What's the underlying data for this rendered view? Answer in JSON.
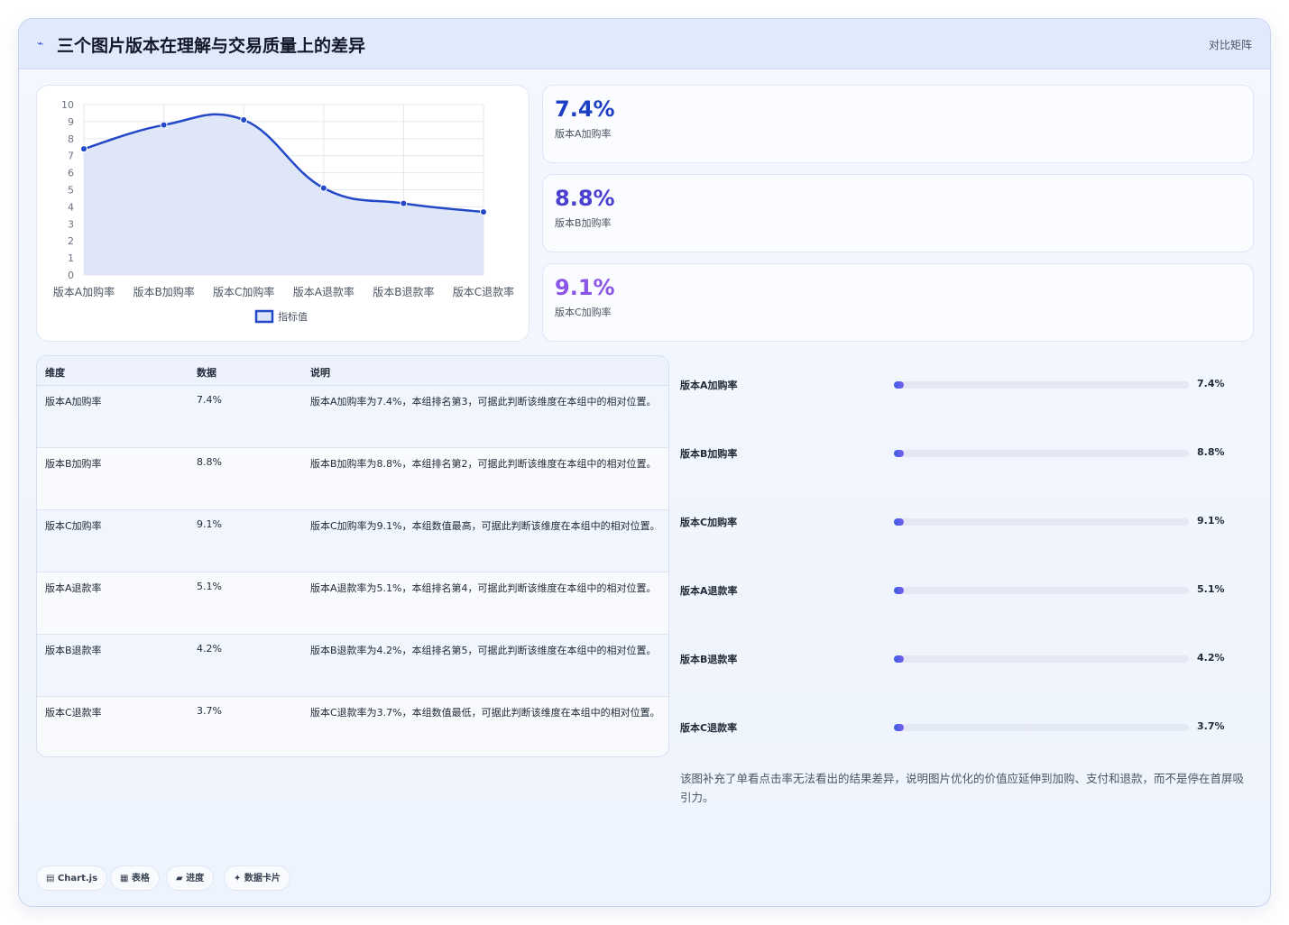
{
  "header": {
    "logo_glyph": "⌁",
    "title": "三个图片版本在理解与交易质量上的差异",
    "badge": "对比矩阵"
  },
  "chart_data": {
    "type": "line",
    "categories": [
      "版本A加购率",
      "版本B加购率",
      "版本C加购率",
      "版本A退款率",
      "版本B退款率",
      "版本C退款率"
    ],
    "series": [
      {
        "name": "指标值",
        "values": [
          7.4,
          8.8,
          9.1,
          5.1,
          4.2,
          3.7
        ]
      }
    ],
    "ylim": [
      0,
      10
    ],
    "yticks": [
      "0",
      "1",
      "2",
      "3",
      "4",
      "5",
      "6",
      "7",
      "8",
      "9",
      "10"
    ],
    "grid": true,
    "legend": "bottom",
    "colors": {
      "line": "#2349c9",
      "fill": "#dde5f7"
    }
  },
  "stats": [
    {
      "value": "7.4%",
      "label": "版本A加购率",
      "color": "#1d3fc4"
    },
    {
      "value": "8.8%",
      "label": "版本B加购率",
      "color": "#4a3fce"
    },
    {
      "value": "9.1%",
      "label": "版本C加购率",
      "color": "#8a54e6"
    }
  ],
  "table": {
    "headers": [
      "维度",
      "数据",
      "说明"
    ],
    "rows": [
      [
        "版本A加购率",
        "7.4%",
        "版本A加购率为7.4%，本组排名第3，可据此判断该维度在本组中的相对位置。"
      ],
      [
        "版本B加购率",
        "8.8%",
        "版本B加购率为8.8%，本组排名第2，可据此判断该维度在本组中的相对位置。"
      ],
      [
        "版本C加购率",
        "9.1%",
        "版本C加购率为9.1%，本组数值最高，可据此判断该维度在本组中的相对位置。"
      ],
      [
        "版本A退款率",
        "5.1%",
        "版本A退款率为5.1%，本组排名第4，可据此判断该维度在本组中的相对位置。"
      ],
      [
        "版本B退款率",
        "4.2%",
        "版本B退款率为4.2%，本组排名第5，可据此判断该维度在本组中的相对位置。"
      ],
      [
        "版本C退款率",
        "3.7%",
        "版本C退款率为3.7%，本组数值最低，可据此判断该维度在本组中的相对位置。"
      ]
    ]
  },
  "progress": [
    {
      "label": "版本A加购率",
      "value": "7.4%",
      "percent": 2
    },
    {
      "label": "版本B加购率",
      "value": "8.8%",
      "percent": 2
    },
    {
      "label": "版本C加购率",
      "value": "9.1%",
      "percent": 2.5
    },
    {
      "label": "版本A退款率",
      "value": "5.1%",
      "percent": 2
    },
    {
      "label": "版本B退款率",
      "value": "4.2%",
      "percent": 2
    },
    {
      "label": "版本C退款率",
      "value": "3.7%",
      "percent": 2
    }
  ],
  "note": "该图补充了单看点击率无法看出的结果差异，说明图片优化的价值应延伸到加购、支付和退款，而不是停在首屏吸引力。",
  "chips": [
    "▤ Chart.js",
    "▦ 表格",
    "▰ 进度",
    "✦ 数据卡片"
  ]
}
